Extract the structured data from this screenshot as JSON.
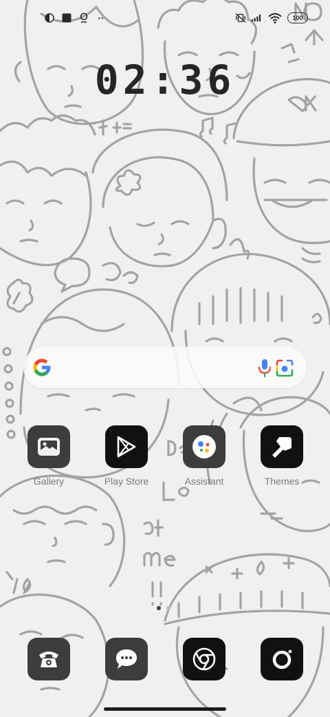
{
  "status_bar": {
    "left_icons": [
      "notification-icon",
      "square-notification-icon",
      "location-icon",
      "more-dots-icon"
    ],
    "right_icons": [
      "vibrate-mute-icon",
      "signal-icon",
      "wifi-icon"
    ],
    "battery_level": "100",
    "more_dots": "··"
  },
  "clock": {
    "time": "02:36"
  },
  "search_widget": {
    "icons": [
      "google-logo-icon",
      "microphone-icon",
      "lens-camera-icon"
    ]
  },
  "apps": [
    {
      "label": "Gallery",
      "icon": "gallery-icon"
    },
    {
      "label": "Play Store",
      "icon": "play-store-icon"
    },
    {
      "label": "Assistant",
      "icon": "assistant-icon"
    },
    {
      "label": "Themes",
      "icon": "themes-brush-icon"
    }
  ],
  "dock": [
    {
      "icon": "phone-icon"
    },
    {
      "icon": "messages-icon"
    },
    {
      "icon": "chrome-icon"
    },
    {
      "icon": "camera-icon"
    }
  ],
  "page_indicator": {
    "pages": 2,
    "current": 1
  },
  "wallpaper": {
    "style": "line-art doodle faces",
    "line_color": "#9e9e9e",
    "background": "#f1f0ee",
    "doodle_text": [
      "NO",
      "OK",
      "1+1=",
      "Don't",
      "Look",
      "at",
      "me",
      "!!"
    ]
  },
  "colors": {
    "google_blue": "#4285F4",
    "google_red": "#EA4335",
    "google_yellow": "#FBBC05",
    "google_green": "#34A853",
    "tile_dark": "#1a1a1a",
    "tile_gray": "#3d3d3d"
  }
}
